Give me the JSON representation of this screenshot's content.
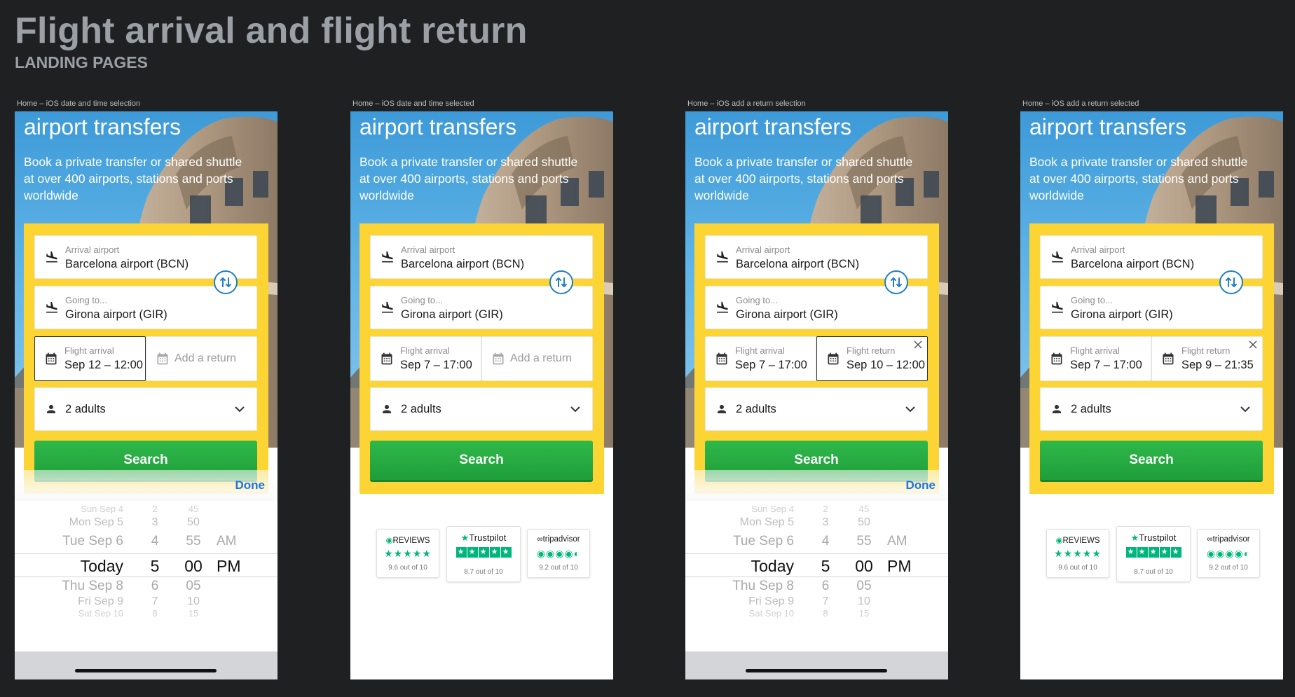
{
  "page": {
    "title": "Flight arrival and flight return",
    "subtitle": "LANDING PAGES"
  },
  "common": {
    "hero_title": "airport transfers",
    "hero_desc": "Book a private transfer or shared shuttle at over 400 airports, stations and ports worldwide",
    "arrival_label": "Arrival airport",
    "arrival_value": "Barcelona airport (BCN)",
    "going_label": "Going to...",
    "going_value": "Girona airport (GIR)",
    "date_label": "Flight arrival",
    "return_label": "Flight return",
    "add_return": "Add a return",
    "passengers": "2 adults",
    "search": "Search",
    "done": "Done"
  },
  "reviews": {
    "r1_brand": "REVIEWS",
    "r1_stars": "★★★★★",
    "r1_score": "9.6 out of 10",
    "r2_brand": "Trustpilot",
    "r2_stars": "★★★★★",
    "r2_score": "8.7 out of 10",
    "r3_brand": "tripadvisor",
    "r3_stars": "◉◉◉◉◐",
    "r3_score": "9.2 out of 10"
  },
  "screens": [
    {
      "label": "Home – iOS date and time selection",
      "arrival_date": "Sep 12 – 12:00",
      "return_date": "",
      "picker": {
        "days": [
          "Sun Sep 4",
          "Mon Sep 5",
          "Tue Sep 6",
          "Today",
          "Thu Sep 8",
          "Fri Sep 9",
          "Sat Sep 10"
        ],
        "hours": [
          "2",
          "3",
          "4",
          "5",
          "6",
          "7",
          "8"
        ],
        "minutes": [
          "45",
          "50",
          "55",
          "00",
          "05",
          "10",
          "15"
        ],
        "ampm": [
          "",
          "",
          "AM",
          "PM",
          "",
          "",
          ""
        ]
      }
    },
    {
      "label": "Home – iOS date and time selected",
      "arrival_date": "Sep 7 – 17:00",
      "return_date": ""
    },
    {
      "label": "Home – iOS add a return selection",
      "arrival_date": "Sep 7 – 17:00",
      "return_date": "Sep 10 – 12:00",
      "picker": {
        "days": [
          "Sun Sep 4",
          "Mon Sep 5",
          "Tue Sep 6",
          "Today",
          "Thu Sep 8",
          "Fri Sep 9",
          "Sat Sep 10"
        ],
        "hours": [
          "2",
          "3",
          "4",
          "5",
          "6",
          "7",
          "8"
        ],
        "minutes": [
          "45",
          "50",
          "55",
          "00",
          "05",
          "10",
          "15"
        ],
        "ampm": [
          "",
          "",
          "AM",
          "PM",
          "",
          "",
          ""
        ]
      }
    },
    {
      "label": "Home – iOS add a return selected",
      "arrival_date": "Sep 7 – 17:00",
      "return_date": "Sep 9 – 21:35"
    }
  ],
  "colors": {
    "background": "#1f2022",
    "form_yellow": "#fcd535",
    "search_green": "#22a83f",
    "done_blue": "#1a73e8",
    "swap_blue": "#1f7fc0",
    "review_green": "#00b67a"
  }
}
